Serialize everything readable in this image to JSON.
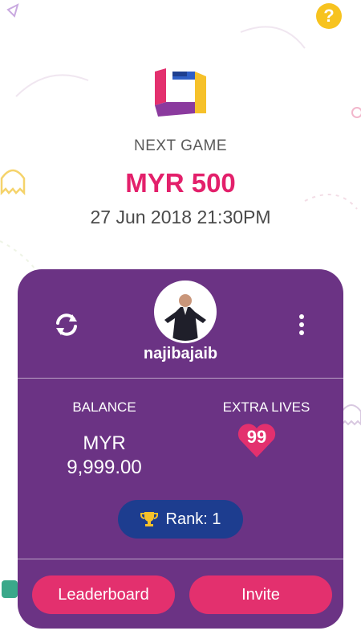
{
  "header": {
    "help_icon_glyph": "?",
    "next_label": "NEXT GAME",
    "prize": "MYR 500",
    "datetime": "27 Jun 2018 21:30PM"
  },
  "profile": {
    "username": "najibajaib"
  },
  "stats": {
    "balance_label": "BALANCE",
    "balance_currency": "MYR",
    "balance_amount": "9,999.00",
    "lives_label": "EXTRA LIVES",
    "lives_count": "99"
  },
  "rank": {
    "label": "Rank: 1"
  },
  "actions": {
    "leaderboard_label": "Leaderboard",
    "invite_label": "Invite"
  },
  "colors": {
    "accent": "#e3206b",
    "card": "#6b3384",
    "rank_pill": "#1d3d8f",
    "help": "#f7c31f"
  }
}
